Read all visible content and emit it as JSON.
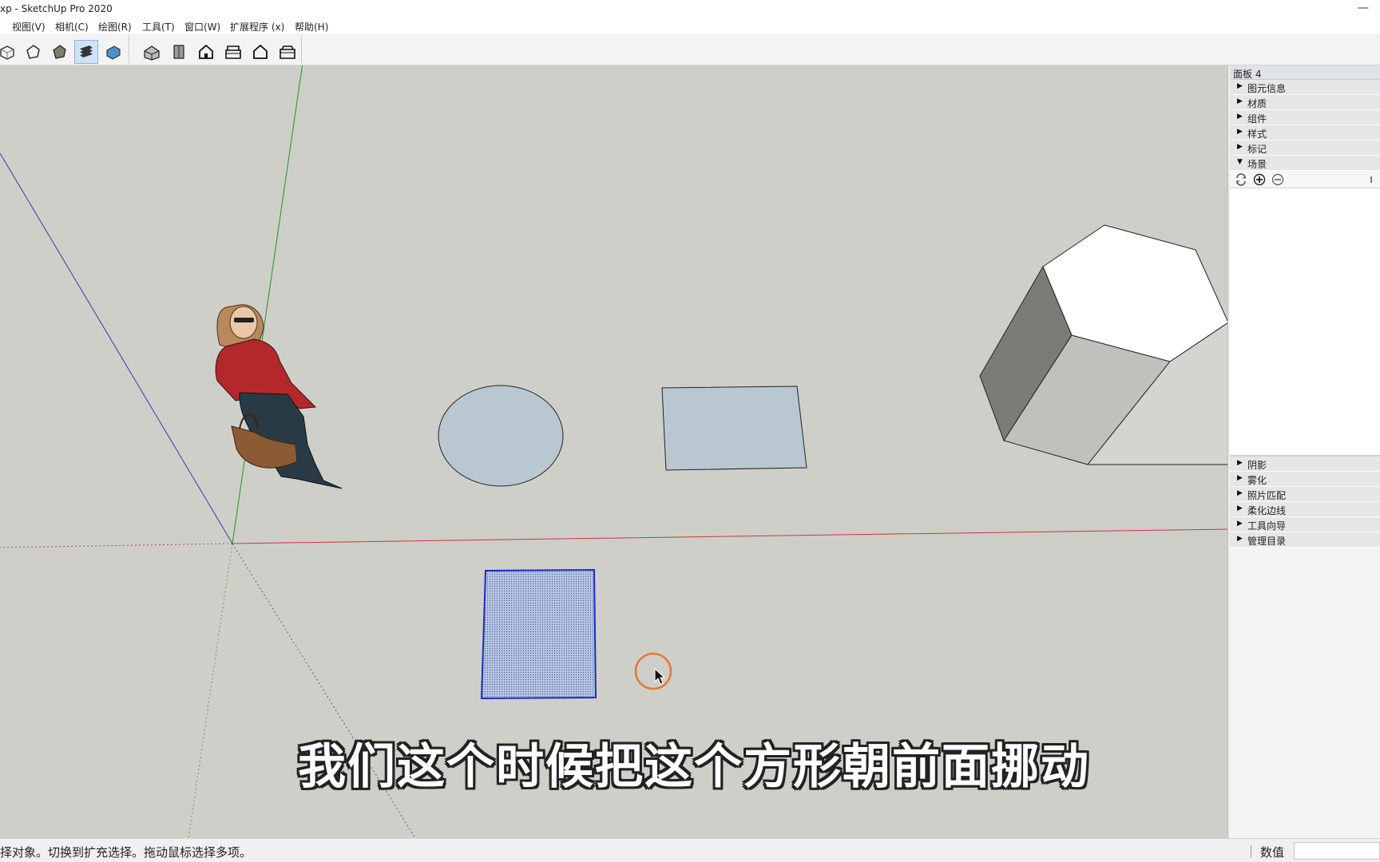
{
  "window": {
    "title": "xp - SketchUp Pro 2020",
    "minimize_glyph": "—"
  },
  "menubar": {
    "items": [
      "视图(V)",
      "相机(C)",
      "绘图(R)",
      "工具(T)",
      "窗口(W)",
      "扩展程序 (x)",
      "帮助(H)"
    ]
  },
  "toolbar": {
    "style_buttons": [
      "xray-style-icon",
      "wireframe-style-icon",
      "shaded-style-icon",
      "shaded-textures-style-icon",
      "monochrome-style-icon"
    ],
    "active_style": "shaded-textures-style-icon",
    "view_buttons": [
      "iso-view-icon",
      "top-view-icon",
      "front-view-icon",
      "right-view-icon",
      "back-view-icon",
      "left-view-icon"
    ]
  },
  "viewport": {
    "background": "#cfcfca",
    "axis_colors": {
      "red": "#c83a3a",
      "green": "#3aa03a",
      "blue": "#3a3aa8"
    },
    "subtitle": "我们这个时候把这个方形朝前面挪动",
    "selected_face_color": "#a8bcdc",
    "face_color": "#b9c8d0"
  },
  "tray": {
    "title": "面板 4",
    "panels_top": [
      {
        "label": "图元信息",
        "expanded": false
      },
      {
        "label": "材质",
        "expanded": false
      },
      {
        "label": "组件",
        "expanded": false
      },
      {
        "label": "样式",
        "expanded": false
      },
      {
        "label": "标记",
        "expanded": false
      },
      {
        "label": "场景",
        "expanded": true
      }
    ],
    "scenes_tools": [
      "refresh-icon",
      "add-scene-icon",
      "remove-scene-icon"
    ],
    "panels_bottom": [
      {
        "label": "阴影",
        "expanded": false
      },
      {
        "label": "雾化",
        "expanded": false
      },
      {
        "label": "照片匹配",
        "expanded": false
      },
      {
        "label": "柔化边线",
        "expanded": false
      },
      {
        "label": "工具向导",
        "expanded": false
      },
      {
        "label": "管理目录",
        "expanded": false
      }
    ]
  },
  "statusbar": {
    "hint": "择对象。切换到扩充选择。拖动鼠标选择多项。",
    "vcb_label": "数值",
    "vcb_value": ""
  }
}
